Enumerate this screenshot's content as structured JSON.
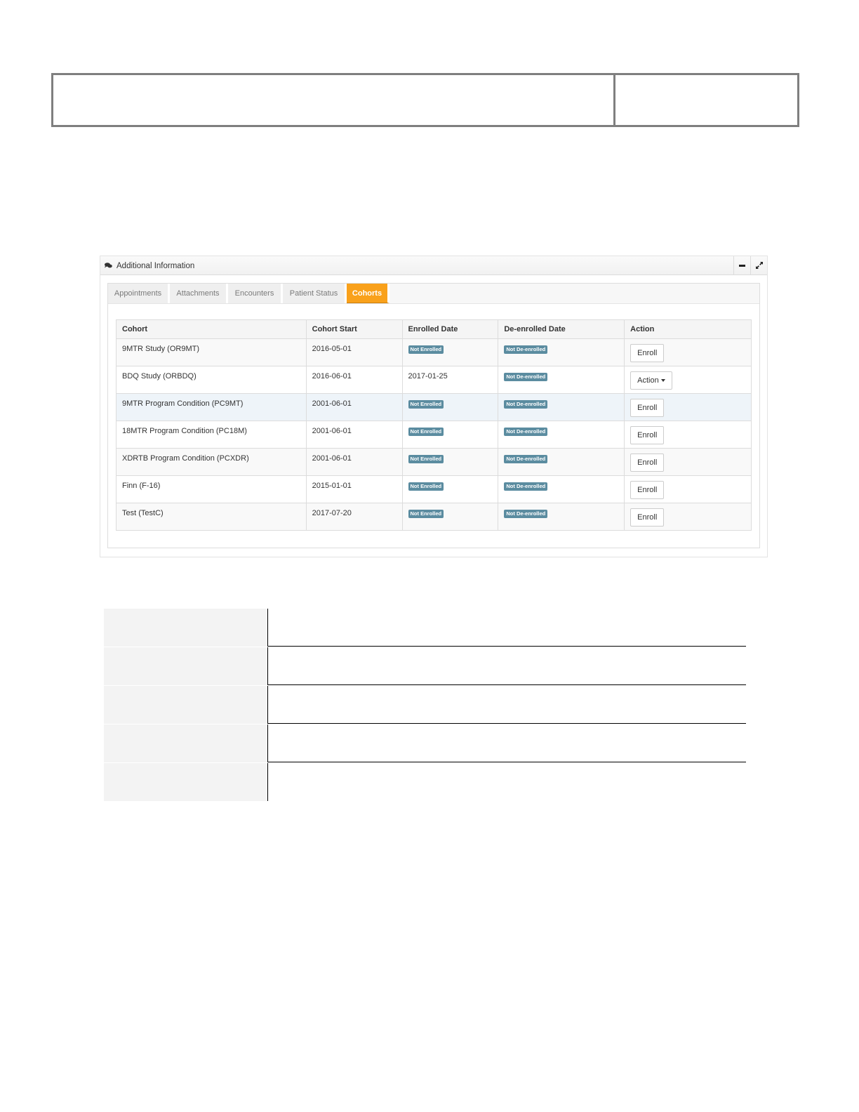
{
  "panel": {
    "title": "Additional Information",
    "title_icon": "comments-icon",
    "buttons": {
      "minimize": "minimize-icon",
      "expand": "expand-icon"
    }
  },
  "tabs": [
    {
      "label": "Appointments",
      "active": false
    },
    {
      "label": "Attachments",
      "active": false
    },
    {
      "label": "Encounters",
      "active": false
    },
    {
      "label": "Patient Status",
      "active": false
    },
    {
      "label": "Cohorts",
      "active": true
    }
  ],
  "table": {
    "headers": [
      "Cohort",
      "Cohort Start",
      "Enrolled Date",
      "De-enrolled Date",
      "Action"
    ],
    "rows": [
      {
        "cohort": "9MTR Study (OR9MT)",
        "start": "2016-05-01",
        "enrolled": "Not Enrolled",
        "deenrolled": "Not De-enrolled",
        "action": "Enroll"
      },
      {
        "cohort": "BDQ Study (ORBDQ)",
        "start": "2016-06-01",
        "enrolled": "2017-01-25",
        "deenrolled": "Not De-enrolled",
        "action": "Action"
      },
      {
        "cohort": "9MTR Program Condition (PC9MT)",
        "start": "2001-06-01",
        "enrolled": "Not Enrolled",
        "deenrolled": "Not De-enrolled",
        "action": "Enroll"
      },
      {
        "cohort": "18MTR Program Condition (PC18M)",
        "start": "2001-06-01",
        "enrolled": "Not Enrolled",
        "deenrolled": "Not De-enrolled",
        "action": "Enroll"
      },
      {
        "cohort": "XDRTB Program Condition (PCXDR)",
        "start": "2001-06-01",
        "enrolled": "Not Enrolled",
        "deenrolled": "Not De-enrolled",
        "action": "Enroll"
      },
      {
        "cohort": "Finn (F-16)",
        "start": "2015-01-01",
        "enrolled": "Not Enrolled",
        "deenrolled": "Not De-enrolled",
        "action": "Enroll"
      },
      {
        "cohort": "Test (TestC)",
        "start": "2017-07-20",
        "enrolled": "Not Enrolled",
        "deenrolled": "Not De-enrolled",
        "action": "Enroll"
      }
    ]
  },
  "colors": {
    "active_tab": "#f9a11b",
    "label_bg": "#5b8ca0",
    "highlight_row": "#eef4f9"
  }
}
